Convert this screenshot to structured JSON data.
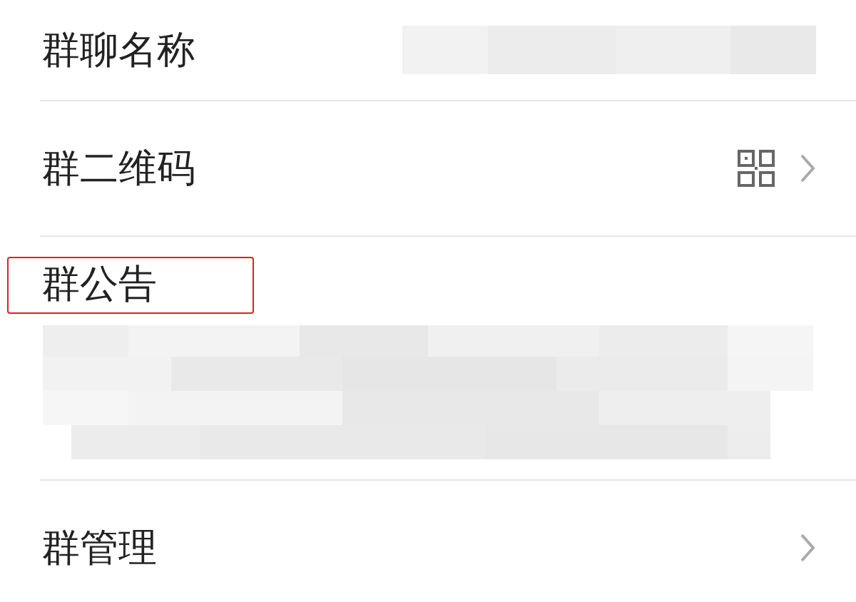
{
  "rows": [
    {
      "kind": "value",
      "label": "群聊名称",
      "highlighted": false
    },
    {
      "kind": "qrcode",
      "label": "群二维码",
      "highlighted": false
    },
    {
      "kind": "notice",
      "label": "群公告",
      "highlighted": true
    },
    {
      "kind": "link",
      "label": "群管理",
      "highlighted": false
    }
  ]
}
